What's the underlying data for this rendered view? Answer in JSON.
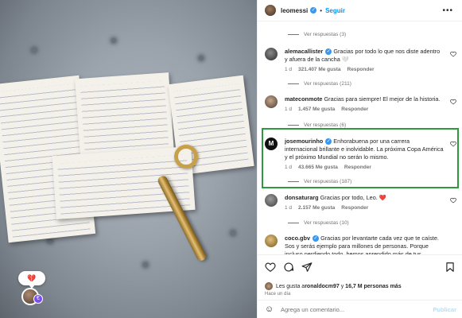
{
  "post": {
    "author": "leomessi",
    "follow_label": "Seguir",
    "more_label": "•••"
  },
  "overlay": {
    "reaction_emoji": "💔",
    "badge_icon": "€"
  },
  "comments": [
    {
      "username": "alemacallister",
      "text": "Gracias por todo lo que nos diste adentro y afuera de la cancha 🤍",
      "age": "1 d",
      "likes": "321.407 Me gusta",
      "reply": "Responder",
      "replies_label": "Ver respuestas (211)"
    },
    {
      "username": "mateconmote",
      "text": "Gracias para siempre! El mejor de la historia.",
      "age": "1 d",
      "likes": "1.457 Me gusta",
      "reply": "Responder",
      "replies_label": "Ver respuestas (6)"
    },
    {
      "username": "josemourinho",
      "text": "Enhorabuena por una carrera internacional brillante e inolvidable. La próxima Copa América y el próximo Mundial no serán lo mismo.",
      "age": "1 d",
      "likes": "43.665 Me gusta",
      "reply": "Responder",
      "replies_label": "Ver respuestas (187)"
    },
    {
      "username": "donsaturarg",
      "text": "Gracias por todo, Leo. ❤️",
      "age": "1 d",
      "likes": "2.157 Me gusta",
      "reply": "Responder",
      "replies_label": "Ver respuestas (10)"
    },
    {
      "username": "coco.gbv",
      "text": "Gracias por levantarte cada vez que te caíste. Sos y serás ejemplo para millones de personas. Porque incluso perdiendo todo, hemos aprendido más de tus derrotas"
    }
  ],
  "top_replies_label": "Ver respuestas (3)",
  "likes_summary": {
    "prefix": "Les gusta a ",
    "user": "ronaldocm97",
    "middle": " y ",
    "count": "16,7 M personas más"
  },
  "post_time": "Hace un día",
  "composer": {
    "placeholder": "Agrega un comentario...",
    "publish_label": "Publicar"
  },
  "colors": {
    "accent": "#0095f6",
    "verified": "#3897f0",
    "highlight_border": "#2e9a3e",
    "heart_red": "#ed4956"
  }
}
